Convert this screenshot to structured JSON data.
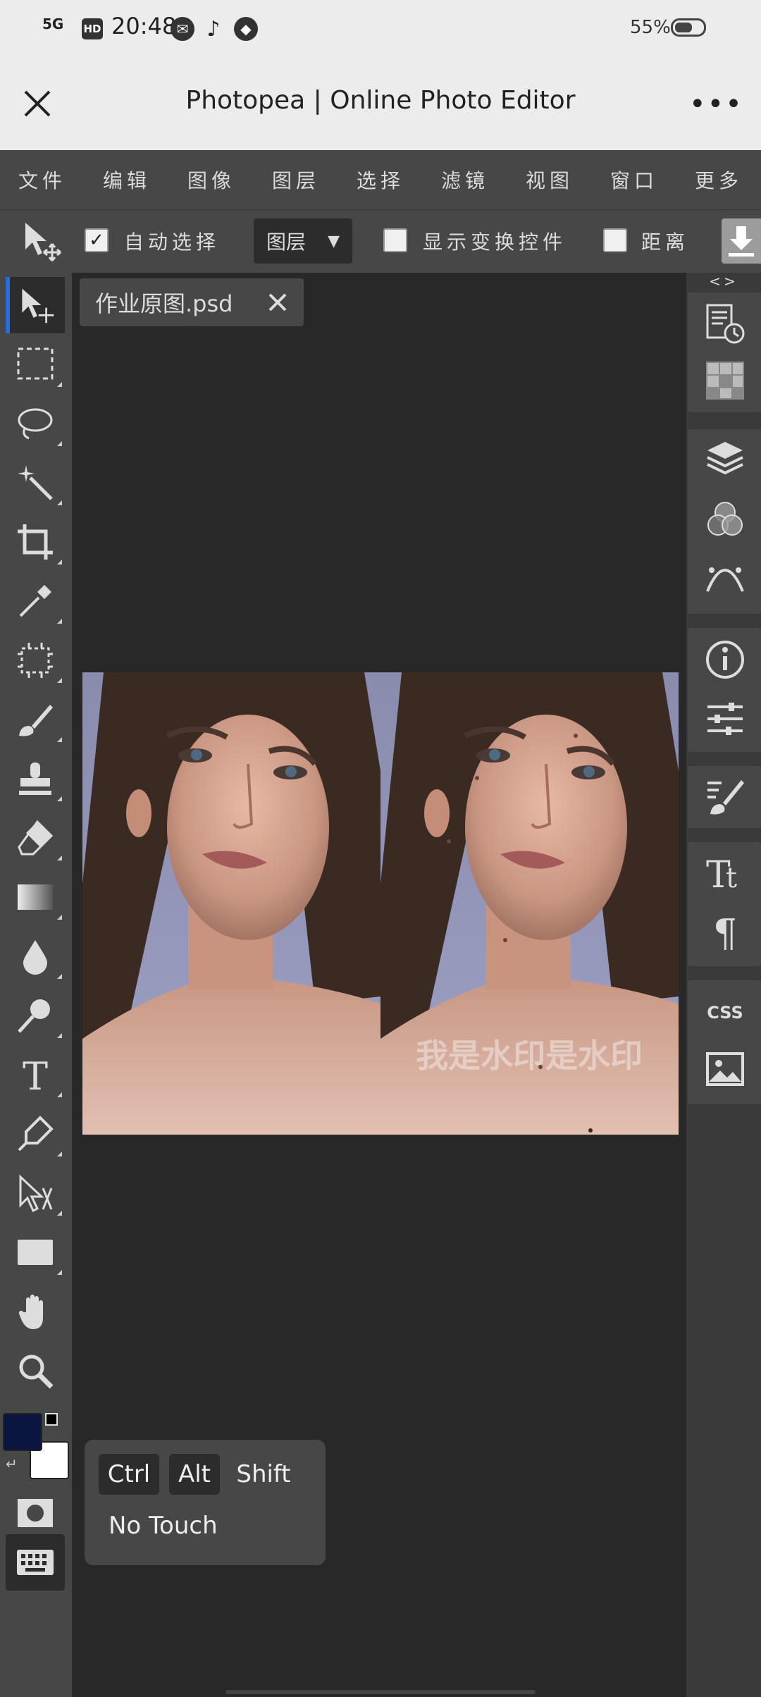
{
  "status_bar": {
    "signal": "5G",
    "hd": "HD",
    "time": "20:48",
    "battery": "55%"
  },
  "title_bar": {
    "title": "Photopea | Online Photo Editor",
    "more": "•••"
  },
  "menu": [
    "文件",
    "编辑",
    "图像",
    "图层",
    "选择",
    "滤镜",
    "视图",
    "窗口",
    "更多"
  ],
  "options": {
    "auto_select_label": "自动选择",
    "auto_select_checked": true,
    "target_dropdown": "图层",
    "show_transform_label": "显示变换控件",
    "distance_label": "距离"
  },
  "document": {
    "tab_name": "作业原图.psd",
    "watermark": "我是水印是水印"
  },
  "right_panel": {
    "toggle": "<>"
  },
  "colors": {
    "foreground": "#0b1640",
    "background": "#ffffff",
    "accent": "#2d6bd6"
  },
  "keyboard_helper": {
    "ctrl": "Ctrl",
    "alt": "Alt",
    "shift": "Shift",
    "no_touch": "No Touch"
  }
}
